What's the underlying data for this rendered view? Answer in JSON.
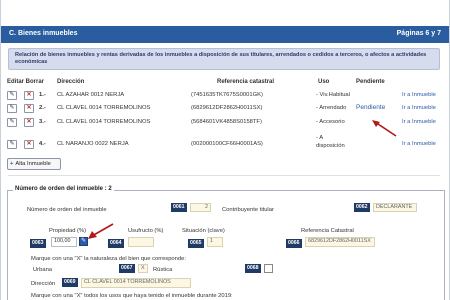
{
  "header": {
    "title": "C. Bienes inmuebles",
    "pages": "Páginas 6 y 7"
  },
  "notice": {
    "text": "Relación de bienes inmuebles y rentas derivadas de los inmuebles a disposición de sus titulares, arrendados o cedidos a terceros, o afectos a actividades económicas"
  },
  "table": {
    "columns": {
      "actions": "Editar Borrar",
      "direccion": "Dirección",
      "referencia": "Referencia catastral",
      "uso": "Uso",
      "pendiente": "Pendiente"
    },
    "rows": [
      {
        "num": "1.-",
        "direccion": "CL AZAHAR 0012 NERJA",
        "referencia": "(7451635TK7675S0001GK)",
        "uso": "- Viv.Habitual",
        "pendiente": "",
        "link": "Ir a Inmueble"
      },
      {
        "num": "2.-",
        "direccion": "CL CLAVEL 0014 TORREMOLINOS",
        "referencia": "(6829612DF2862H0011SX)",
        "uso": "- Arrendado",
        "pendiente": "Pendiente",
        "link": "Ir a Inmueble"
      },
      {
        "num": "3.-",
        "direccion": "CL CLAVEL 0014 TORREMOLINOS",
        "referencia": "(5684601VK4858S0158TF)",
        "uso": "- Accesorio",
        "pendiente": "",
        "link": "Ir a Inmueble"
      },
      {
        "num": "4.-",
        "direccion": "CL NARANJO 0022 NERJA",
        "referencia": "(002000100CF66H0001AS)",
        "uso_line1": "- A",
        "uso_line2": "disposición",
        "pendiente": "",
        "link": "Ir a Inmueble"
      }
    ],
    "add_button": "Alta Inmueble",
    "edit_icon": "pencil-icon",
    "delete_icon": "x-icon"
  },
  "detail": {
    "legend": "Número de orden del inmueble : 2",
    "orden_label": "Número de orden del inmueble",
    "orden_code": "0061",
    "orden_value": "2",
    "contribuyente_label": "Contribuyente titular",
    "contribuyente_code": "0062",
    "contribuyente_value": "DECLARANTE",
    "propiedad_label": "Propiedad (%)",
    "propiedad_code": "0063",
    "propiedad_value": "100,00",
    "usufructo_label": "Usufructo (%)",
    "usufructo_code": "0064",
    "usufructo_value": "",
    "situacion_label": "Situación (clave)",
    "situacion_code": "0065",
    "situacion_value": "1",
    "referencia_label": "Referencia Catastral",
    "referencia_code": "0066",
    "referencia_value": "6829612DF2862H0011SX",
    "naturaleza_label": "Marque con una \"X\" la naturaleza del bien que corresponde:",
    "urbana_label": "Urbana",
    "urbana_code": "0067",
    "urbana_checked": true,
    "rustica_label": "Rústica",
    "rustica_code": "0068",
    "rustica_checked": false,
    "direccion_label": "Dirección",
    "direccion_code": "0069",
    "direccion_value": "CL CLAVEL 0014 TORREMOLINOS",
    "usos_label": "Marque con una \"X\" todos los usos que haya tenido el inmueble durante 2019:"
  },
  "colors": {
    "header": "#2a5d9f",
    "code_badge": "#203a66",
    "link": "#2a5aa8",
    "arrow": "#b11a1a"
  }
}
